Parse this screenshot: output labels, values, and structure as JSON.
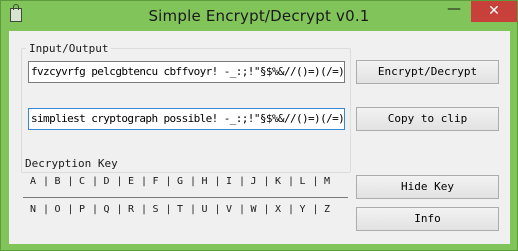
{
  "window": {
    "title": "Simple Encrypt/Decrypt v0.1",
    "minimize_glyph": "—",
    "close_glyph": "✕"
  },
  "io_group": {
    "label": "Input/Output",
    "input_text": "fvzcyvrfg pelcgbtencu cbffvoyr! -_:;!\"§$%&//()=)(/=)",
    "output_text": "simpliest cryptograph possible! -_:;!\"§$%&//()=)(/=)"
  },
  "buttons": {
    "encrypt_decrypt": "Encrypt/Decrypt",
    "copy_to_clip": "Copy to clip",
    "hide_key": "Hide Key",
    "info": "Info"
  },
  "decryption_key": {
    "label": "Decryption Key",
    "row1": [
      "A",
      "B",
      "C",
      "D",
      "E",
      "F",
      "G",
      "H",
      "I",
      "J",
      "K",
      "L",
      "M"
    ],
    "row2": [
      "N",
      "O",
      "P",
      "Q",
      "R",
      "S",
      "T",
      "U",
      "V",
      "W",
      "X",
      "Y",
      "Z"
    ]
  }
}
